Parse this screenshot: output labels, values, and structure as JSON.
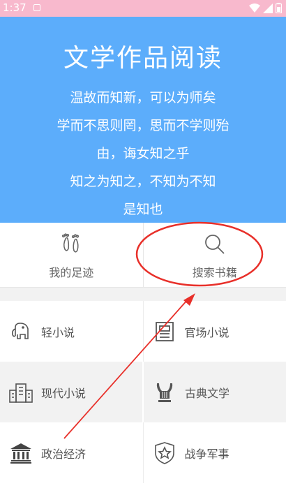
{
  "status_bar": {
    "time": "1:37",
    "icons": [
      "notification-icon",
      "wifi-icon",
      "signal-icon",
      "battery-icon"
    ]
  },
  "hero": {
    "title": "文学作品阅读",
    "poem_lines": [
      "温故而知新，可以为师矣",
      "学而不思则罔，思而不学则殆",
      "由，诲女知之乎",
      "知之为知之，不知为不知",
      "是知也"
    ],
    "background_color": "#5cadfb"
  },
  "quick_actions": [
    {
      "label": "我的足迹",
      "icon": "footprints-icon"
    },
    {
      "label": "搜索书籍",
      "icon": "search-icon"
    }
  ],
  "categories": [
    {
      "label": "轻小说",
      "icon": "elephant-icon"
    },
    {
      "label": "官场小说",
      "icon": "newspaper-icon"
    },
    {
      "label": "现代小说",
      "icon": "buildings-icon"
    },
    {
      "label": "古典文学",
      "icon": "lyre-icon"
    },
    {
      "label": "政治经济",
      "icon": "government-building-icon"
    },
    {
      "label": "战争军事",
      "icon": "star-shield-icon"
    }
  ],
  "annotation": {
    "color": "#e8302a",
    "highlighted_item": "搜索书籍"
  }
}
